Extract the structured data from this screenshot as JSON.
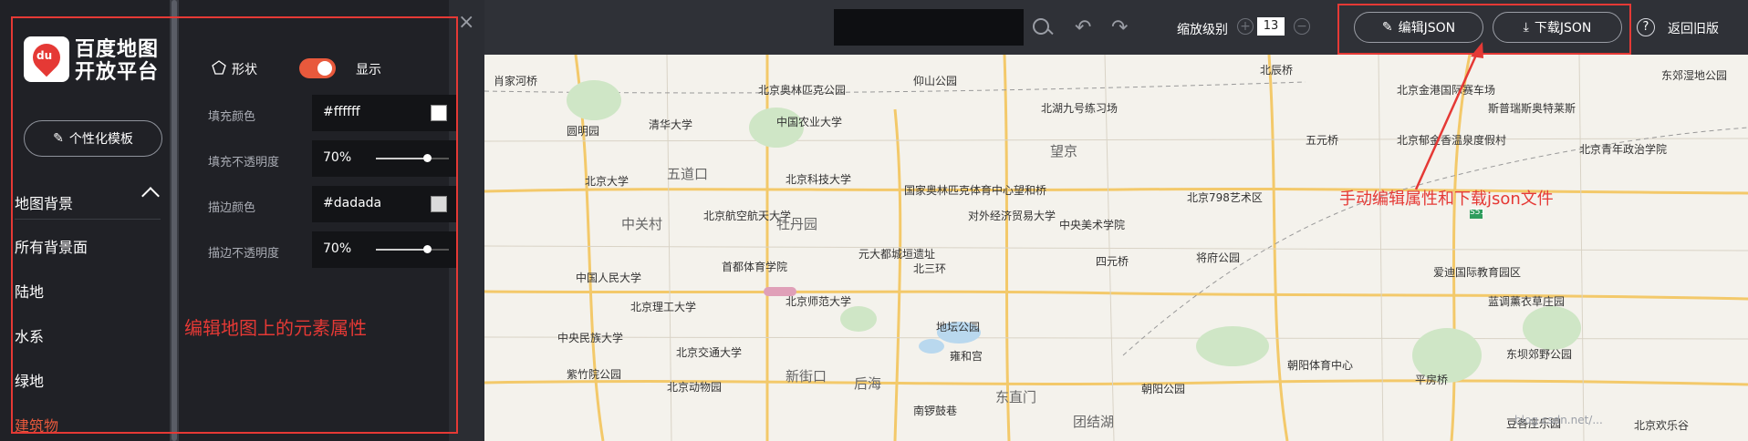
{
  "brand": {
    "badge": "du",
    "name": "百度地图开放平台"
  },
  "template_button": "个性化模板",
  "sidebar": {
    "section_title": "地图背景",
    "items": [
      "所有背景面",
      "陆地",
      "水系",
      "绿地",
      "建筑物"
    ]
  },
  "props": {
    "shape_label": "形状",
    "show_label": "显示",
    "fill_color": {
      "label": "填充颜色",
      "value": "#ffffff"
    },
    "fill_opacity": {
      "label": "填充不透明度",
      "value": "70%",
      "level": 0.7
    },
    "stroke_color": {
      "label": "描边颜色",
      "value": "#dadada"
    },
    "stroke_opacity": {
      "label": "描边不透明度",
      "value": "70%",
      "level": 0.7
    }
  },
  "annotations": {
    "left": "编辑地图上的元素属性",
    "right": "手动编辑属性和下载json文件"
  },
  "topbar": {
    "zoom_label": "缩放级别",
    "zoom_value": "13",
    "edit_json": "编辑JSON",
    "download_json": "下载JSON",
    "legacy": "返回旧版"
  },
  "map": {
    "labels": [
      "肖家河桥",
      "北京奥林匹克公园",
      "仰山公园",
      "北湖九号练习场",
      "北辰桥",
      "北京金港国际赛车场",
      "斯普瑞斯奥特莱斯",
      "东郊湿地公园",
      "圆明园",
      "清华大学",
      "中国农业大学",
      "望京",
      "五元桥",
      "北京郁金香温泉度假村",
      "北京青年政治学院",
      "五道口",
      "北京大学",
      "北京科技大学",
      "国家奥林匹克体育中心",
      "望和桥",
      "北京798艺术区",
      "中关村",
      "北京航空航天大学",
      "牡丹园",
      "对外经济贸易大学",
      "中央美术学院",
      "中国人民大学",
      "首都体育学院",
      "元大都城垣遗址",
      "北三环",
      "四元桥",
      "将府公园",
      "爱迪国际教育园区",
      "北京理工大学",
      "北京师范大学",
      "蓝调薰衣草庄园",
      "中央民族大学",
      "北京交通大学",
      "地坛公园",
      "东坝郊野公园",
      "紫竹院公园",
      "北京动物园",
      "新街口",
      "后海",
      "雍和宫",
      "朝阳体育中心",
      "朝阳公园",
      "平房桥",
      "东直门",
      "南锣鼓巷",
      "团结湖",
      "豆各庄乐园",
      "北京欢乐谷",
      "S51"
    ]
  },
  "watermark": "blog.csdn.net/..."
}
